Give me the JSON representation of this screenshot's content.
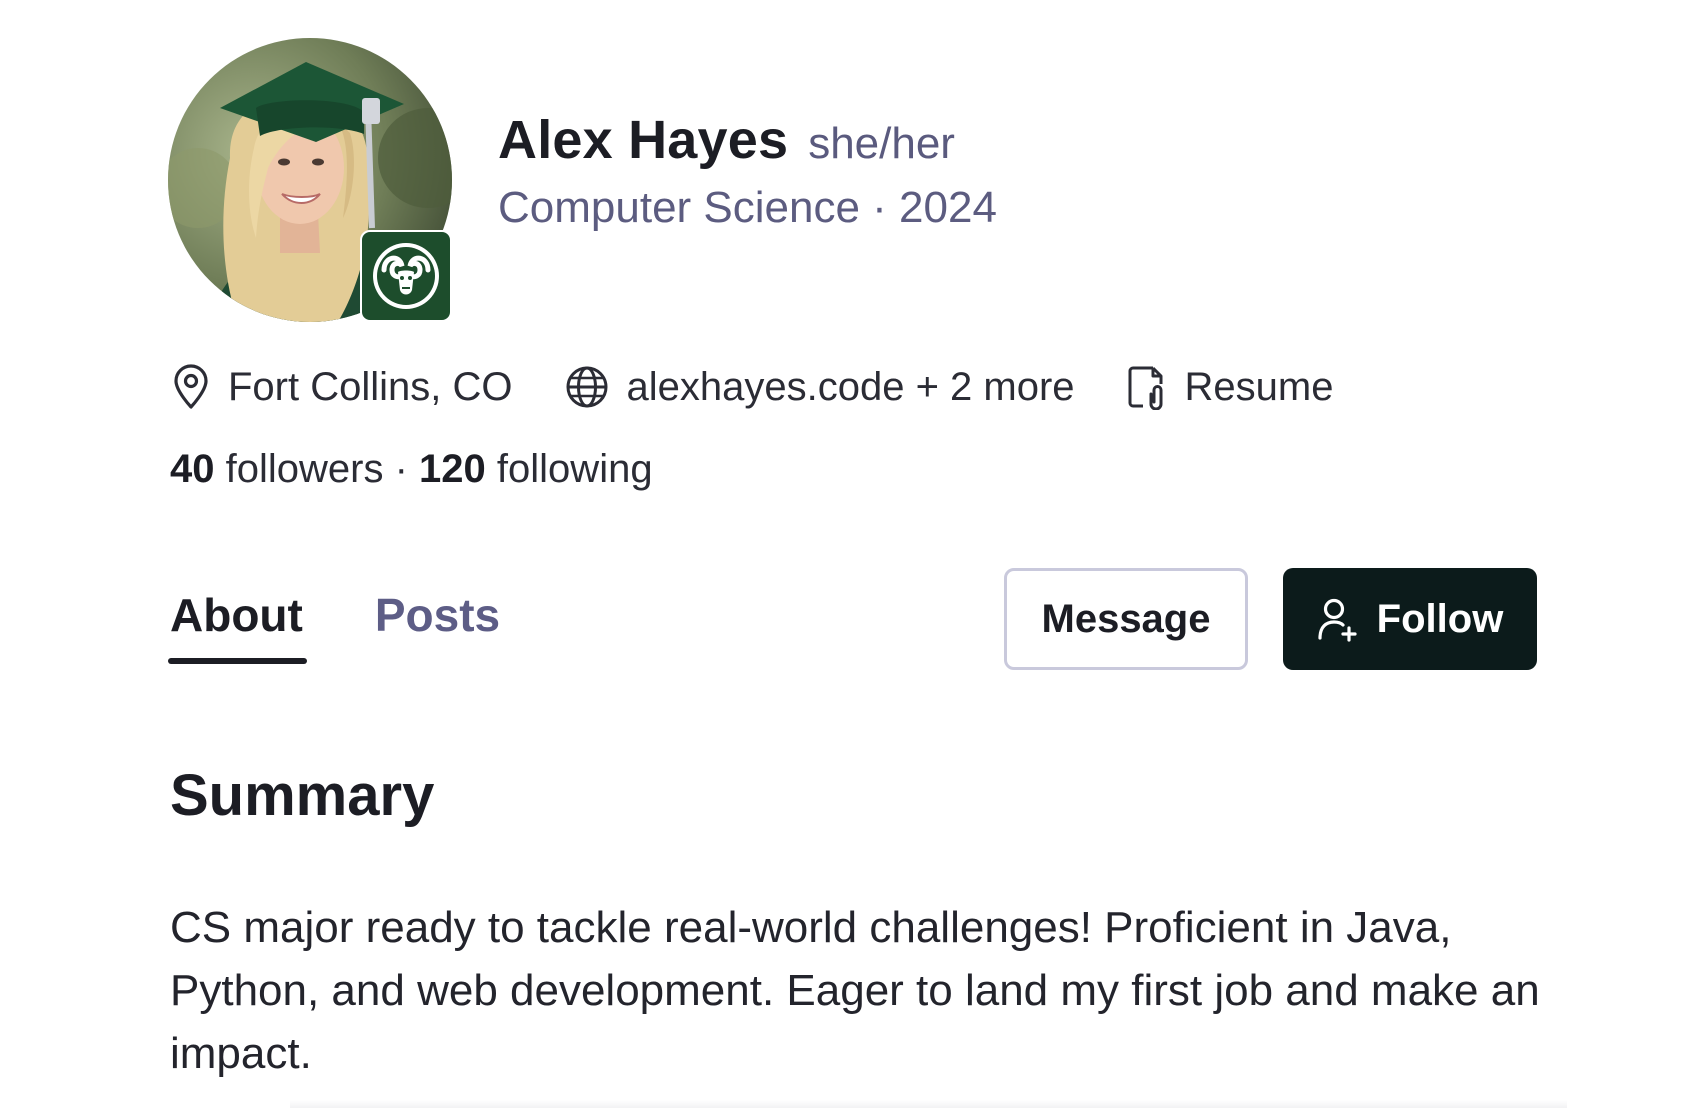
{
  "profile": {
    "name": "Alex Hayes",
    "pronouns": "she/her",
    "subtitle": "Computer Science · 2024",
    "avatar_icon": "profile-photo",
    "badge_icon": "ram-mascot-icon",
    "badge_color": "#1d4d2c"
  },
  "meta": {
    "location": "Fort Collins, CO",
    "website": "alexhayes.code + 2 more",
    "resume": "Resume",
    "icons": [
      "location-pin-icon",
      "globe-icon",
      "document-attachment-icon"
    ]
  },
  "stats": {
    "followers_count": "40",
    "followers_label": "followers",
    "separator": "·",
    "following_count": "120",
    "following_label": "following"
  },
  "tabs": [
    {
      "label": "About",
      "active": true
    },
    {
      "label": "Posts",
      "active": false
    }
  ],
  "actions": {
    "message_label": "Message",
    "follow_label": "Follow",
    "follow_icon": "add-user-icon",
    "follow_bg": "#0c1b1b"
  },
  "summary": {
    "title": "Summary",
    "text": "CS major ready to tackle real-world challenges! Proficient in Java, Python, and web development. Eager to land my first job and make an impact."
  }
}
